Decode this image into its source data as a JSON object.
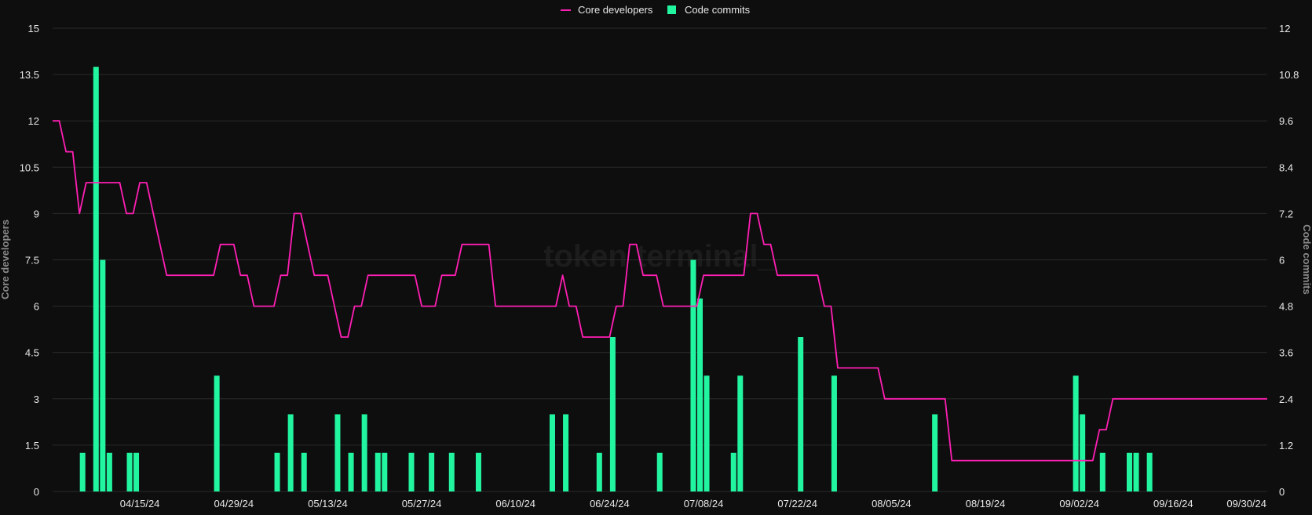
{
  "watermark": "token terminal_",
  "chart_data": {
    "type": "bar+line",
    "x_tick_labels": [
      "04/15/24",
      "04/29/24",
      "05/13/24",
      "05/27/24",
      "06/10/24",
      "06/24/24",
      "07/08/24",
      "07/22/24",
      "08/05/24",
      "08/19/24",
      "09/02/24",
      "09/16/24",
      "09/30/24"
    ],
    "x_range": [
      "2024-04-02",
      "2024-09-30"
    ],
    "left_axis": {
      "label": "Core developers",
      "ticks": [
        "0",
        "1.5",
        "3",
        "4.5",
        "6",
        "7.5",
        "9",
        "10.5",
        "12",
        "13.5",
        "15"
      ],
      "range": [
        0,
        15
      ]
    },
    "right_axis": {
      "label": "Code commits",
      "ticks": [
        "0",
        "1.2",
        "2.4",
        "3.6",
        "4.8",
        "6",
        "7.2",
        "8.4",
        "9.6",
        "10.8",
        "12"
      ],
      "range": [
        0,
        12
      ]
    },
    "legend": {
      "placement": "top-center"
    },
    "series": [
      {
        "name": "Core developers",
        "type": "line",
        "axis": "left",
        "color": "#ff1fb4",
        "points": [
          [
            "2024-04-02",
            12
          ],
          [
            "2024-04-03",
            12
          ],
          [
            "2024-04-04",
            11
          ],
          [
            "2024-04-05",
            11
          ],
          [
            "2024-04-06",
            9
          ],
          [
            "2024-04-07",
            10
          ],
          [
            "2024-04-08",
            10
          ],
          [
            "2024-04-12",
            10
          ],
          [
            "2024-04-13",
            9
          ],
          [
            "2024-04-14",
            9
          ],
          [
            "2024-04-15",
            10
          ],
          [
            "2024-04-16",
            10
          ],
          [
            "2024-04-19",
            7
          ],
          [
            "2024-04-26",
            7
          ],
          [
            "2024-04-27",
            8
          ],
          [
            "2024-04-29",
            8
          ],
          [
            "2024-04-30",
            7
          ],
          [
            "2024-05-01",
            7
          ],
          [
            "2024-05-02",
            6
          ],
          [
            "2024-05-05",
            6
          ],
          [
            "2024-05-06",
            7
          ],
          [
            "2024-05-07",
            7
          ],
          [
            "2024-05-08",
            9
          ],
          [
            "2024-05-09",
            9
          ],
          [
            "2024-05-11",
            7
          ],
          [
            "2024-05-13",
            7
          ],
          [
            "2024-05-15",
            5
          ],
          [
            "2024-05-16",
            5
          ],
          [
            "2024-05-17",
            6
          ],
          [
            "2024-05-18",
            6
          ],
          [
            "2024-05-19",
            7
          ],
          [
            "2024-05-26",
            7
          ],
          [
            "2024-05-27",
            6
          ],
          [
            "2024-05-29",
            6
          ],
          [
            "2024-05-30",
            7
          ],
          [
            "2024-06-01",
            7
          ],
          [
            "2024-06-02",
            8
          ],
          [
            "2024-06-06",
            8
          ],
          [
            "2024-06-07",
            6
          ],
          [
            "2024-06-16",
            6
          ],
          [
            "2024-06-17",
            7
          ],
          [
            "2024-06-18",
            6
          ],
          [
            "2024-06-19",
            6
          ],
          [
            "2024-06-20",
            5
          ],
          [
            "2024-06-24",
            5
          ],
          [
            "2024-06-25",
            6
          ],
          [
            "2024-06-26",
            6
          ],
          [
            "2024-06-27",
            8
          ],
          [
            "2024-06-28",
            8
          ],
          [
            "2024-06-29",
            7
          ],
          [
            "2024-07-01",
            7
          ],
          [
            "2024-07-02",
            6
          ],
          [
            "2024-07-07",
            6
          ],
          [
            "2024-07-08",
            7
          ],
          [
            "2024-07-14",
            7
          ],
          [
            "2024-07-15",
            9
          ],
          [
            "2024-07-16",
            9
          ],
          [
            "2024-07-17",
            8
          ],
          [
            "2024-07-18",
            8
          ],
          [
            "2024-07-19",
            7
          ],
          [
            "2024-07-25",
            7
          ],
          [
            "2024-07-26",
            6
          ],
          [
            "2024-07-27",
            6
          ],
          [
            "2024-07-28",
            4
          ],
          [
            "2024-08-03",
            4
          ],
          [
            "2024-08-04",
            3
          ],
          [
            "2024-08-13",
            3
          ],
          [
            "2024-08-14",
            1
          ],
          [
            "2024-09-03",
            1
          ],
          [
            "2024-09-04",
            1
          ],
          [
            "2024-09-05",
            2
          ],
          [
            "2024-09-06",
            2
          ],
          [
            "2024-09-07",
            3
          ],
          [
            "2024-09-30",
            3
          ]
        ]
      },
      {
        "name": "Code commits",
        "type": "bar",
        "axis": "right",
        "color": "#22f5a0",
        "points": [
          [
            "2024-04-06",
            1
          ],
          [
            "2024-04-08",
            11
          ],
          [
            "2024-04-09",
            6
          ],
          [
            "2024-04-10",
            1
          ],
          [
            "2024-04-13",
            1
          ],
          [
            "2024-04-14",
            1
          ],
          [
            "2024-04-26",
            3
          ],
          [
            "2024-05-05",
            1
          ],
          [
            "2024-05-07",
            2
          ],
          [
            "2024-05-09",
            1
          ],
          [
            "2024-05-14",
            2
          ],
          [
            "2024-05-16",
            1
          ],
          [
            "2024-05-18",
            2
          ],
          [
            "2024-05-20",
            1
          ],
          [
            "2024-05-21",
            1
          ],
          [
            "2024-05-25",
            1
          ],
          [
            "2024-05-28",
            1
          ],
          [
            "2024-05-31",
            1
          ],
          [
            "2024-06-04",
            1
          ],
          [
            "2024-06-15",
            2
          ],
          [
            "2024-06-17",
            2
          ],
          [
            "2024-06-22",
            1
          ],
          [
            "2024-06-24",
            4
          ],
          [
            "2024-07-01",
            1
          ],
          [
            "2024-07-06",
            6
          ],
          [
            "2024-07-07",
            5
          ],
          [
            "2024-07-08",
            3
          ],
          [
            "2024-07-12",
            1
          ],
          [
            "2024-07-13",
            3
          ],
          [
            "2024-07-22",
            4
          ],
          [
            "2024-07-27",
            3
          ],
          [
            "2024-08-11",
            2
          ],
          [
            "2024-09-01",
            3
          ],
          [
            "2024-09-02",
            2
          ],
          [
            "2024-09-05",
            1
          ],
          [
            "2024-09-09",
            1
          ],
          [
            "2024-09-10",
            1
          ],
          [
            "2024-09-12",
            1
          ]
        ]
      }
    ]
  }
}
